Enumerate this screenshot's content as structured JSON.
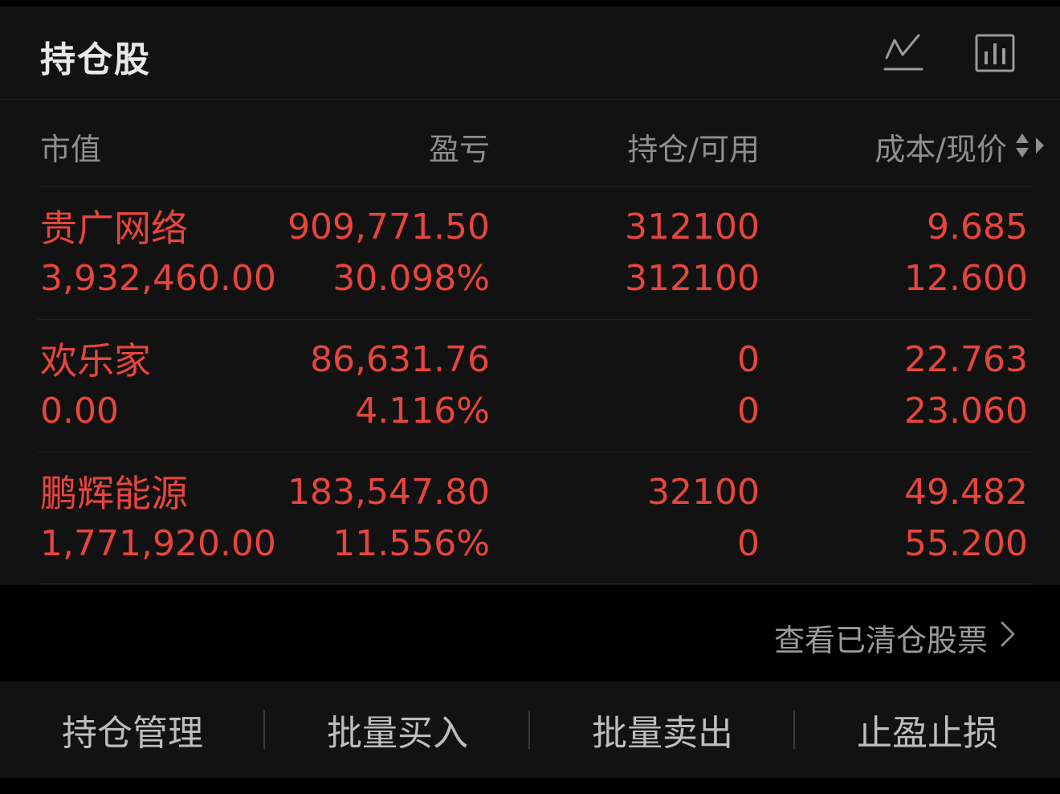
{
  "header": {
    "title": "持仓股",
    "icons": [
      "line-chart-icon",
      "bar-chart-icon"
    ]
  },
  "columns": {
    "market_value": "市值",
    "pnl": "盈亏",
    "position": "持仓/可用",
    "cost_price": "成本/现价"
  },
  "colors": {
    "up_red": "#e8453c",
    "background": "#121212",
    "muted_text": "#8e8e8e"
  },
  "holdings": [
    {
      "name": "贵广网络",
      "market_value": "3,932,460.00",
      "pnl": "909,771.50",
      "pnl_pct": "30.098%",
      "position": "312100",
      "available": "312100",
      "cost": "9.685",
      "price": "12.600"
    },
    {
      "name": "欢乐家",
      "market_value": "0.00",
      "pnl": "86,631.76",
      "pnl_pct": "4.116%",
      "position": "0",
      "available": "0",
      "cost": "22.763",
      "price": "23.060"
    },
    {
      "name": "鹏辉能源",
      "market_value": "1,771,920.00",
      "pnl": "183,547.80",
      "pnl_pct": "11.556%",
      "position": "32100",
      "available": "0",
      "cost": "49.482",
      "price": "55.200"
    }
  ],
  "cleared_link": "查看已清仓股票",
  "toolbar": {
    "manage": "持仓管理",
    "batch_buy": "批量买入",
    "batch_sell": "批量卖出",
    "stop": "止盈止损"
  }
}
